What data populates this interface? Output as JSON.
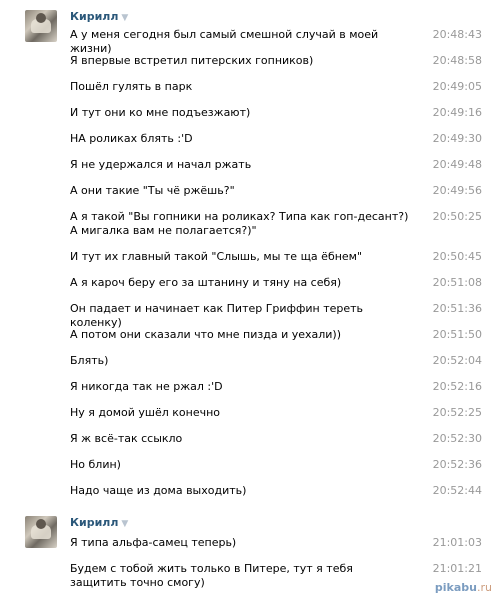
{
  "author": "Кирилл",
  "caret": "▼",
  "group1": [
    {
      "text": "А у меня сегодня был самый смешной случай в моей жизни)",
      "time": "20:48:43"
    },
    {
      "text": "Я впервые встретил питерских гопников)",
      "time": "20:48:58"
    },
    {
      "text": "Пошёл гулять в парк",
      "time": "20:49:05"
    },
    {
      "text": "И тут они ко мне подъезжают)",
      "time": "20:49:16"
    },
    {
      "text": "НА роликах блять :'D",
      "time": "20:49:30"
    },
    {
      "text": "Я не удержался и начал ржать",
      "time": "20:49:48"
    },
    {
      "text": "А они такие \"Ты чё ржёшь?\"",
      "time": "20:49:56"
    },
    {
      "text": "А я такой \"Вы гопники на роликах? Типа как гоп-десант?) А мигалка вам не полагается?)\"",
      "time": "20:50:25"
    },
    {
      "text": "И тут их главный такой \"Слышь, мы те ща ёбнем\"",
      "time": "20:50:45"
    },
    {
      "text": "А я кароч беру его за штанину и тяну на себя)",
      "time": "20:51:08"
    },
    {
      "text": "Он падает и начинает как Питер Гриффин тереть коленку)",
      "time": "20:51:36"
    },
    {
      "text": "А потом они сказали что мне пизда и уехали))",
      "time": "20:51:50"
    },
    {
      "text": "Блять)",
      "time": "20:52:04"
    },
    {
      "text": "Я никогда так не ржал :'D",
      "time": "20:52:16"
    },
    {
      "text": "Ну я домой ушёл конечно",
      "time": "20:52:25"
    },
    {
      "text": "Я ж всё-так ссыкло",
      "time": "20:52:30"
    },
    {
      "text": "Но блин)",
      "time": "20:52:36"
    },
    {
      "text": "Надо чаще из дома выходить)",
      "time": "20:52:44"
    }
  ],
  "group2": [
    {
      "text": "Я типа альфа-самец теперь)",
      "time": "21:01:03"
    },
    {
      "text": "Будем с тобой жить только в Питере, тут я тебя защитить точно смогу)",
      "time": "21:01:21"
    }
  ],
  "watermark": {
    "brand": "pikabu",
    "tld": ".ru"
  }
}
